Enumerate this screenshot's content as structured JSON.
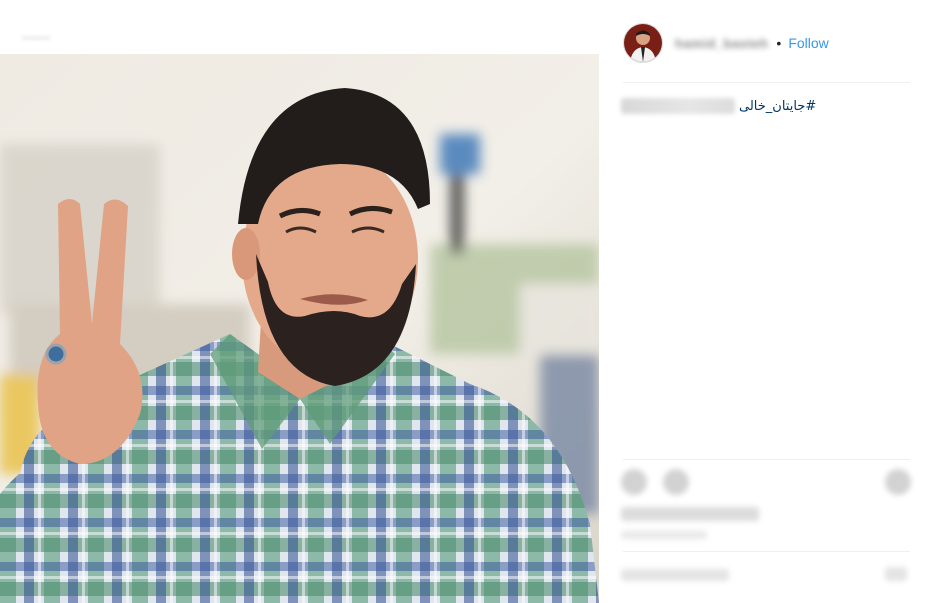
{
  "post": {
    "photo_alt": "",
    "header": {
      "username": "hamid_basteh",
      "separator": "•",
      "follow_label": "Follow"
    },
    "caption": {
      "hashtag": "#جایتان_خالی"
    }
  },
  "colors": {
    "follow": "#3897f0",
    "hashtag": "#003569",
    "divider": "#efefef"
  },
  "icons": [
    "like-icon",
    "comment-icon",
    "bookmark-icon",
    "more-icon"
  ]
}
